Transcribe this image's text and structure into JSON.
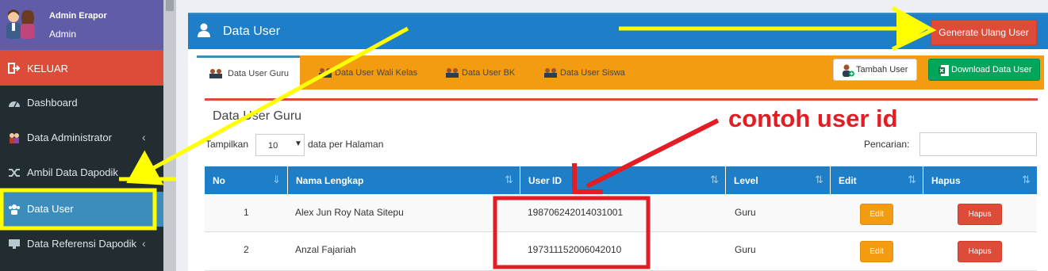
{
  "sidebar": {
    "user_name": "Admin Erapor",
    "user_role": "Admin",
    "logout": "KELUAR",
    "items": [
      {
        "label": "Dashboard"
      },
      {
        "label": "Data Administrator"
      },
      {
        "label": "Ambil Data Dapodik"
      },
      {
        "label": "Data User"
      },
      {
        "label": "Data Referensi Dapodik"
      }
    ]
  },
  "box": {
    "title": "Data User",
    "generate_button": "Generate Ulang User"
  },
  "tabs": [
    {
      "label": "Data User Guru",
      "active": true
    },
    {
      "label": "Data User Wali Kelas"
    },
    {
      "label": "Data User BK"
    },
    {
      "label": "Data User Siswa"
    }
  ],
  "actions": {
    "add_user": "Tambah User",
    "download": "Download Data User"
  },
  "panel": {
    "title": "Data User Guru",
    "show_label": "Tampilkan",
    "page_size": "10",
    "show_suffix": "data per Halaman",
    "search_label": "Pencarian:"
  },
  "table": {
    "columns": [
      "No",
      "Nama Lengkap",
      "User ID",
      "Level",
      "Edit",
      "Hapus"
    ],
    "rows": [
      {
        "no": "1",
        "name": "Alex Jun Roy Nata Sitepu",
        "user_id": "198706242014031001",
        "level": "Guru",
        "edit": "Edit",
        "delete": "Hapus"
      },
      {
        "no": "2",
        "name": "Anzal Fajariah",
        "user_id": "197311152006042010",
        "level": "Guru",
        "edit": "Edit",
        "delete": "Hapus"
      }
    ]
  },
  "annotation": {
    "text": "contoh user id",
    "color": "#e31d24",
    "arrow_color": "#ffff00"
  },
  "colors": {
    "sidebar_bg": "#222d32",
    "user_panel": "#605ca8",
    "header_blue": "#1e7ec8",
    "tab_orange": "#f39c12",
    "danger": "#dd4b39",
    "success": "#00a65a"
  }
}
